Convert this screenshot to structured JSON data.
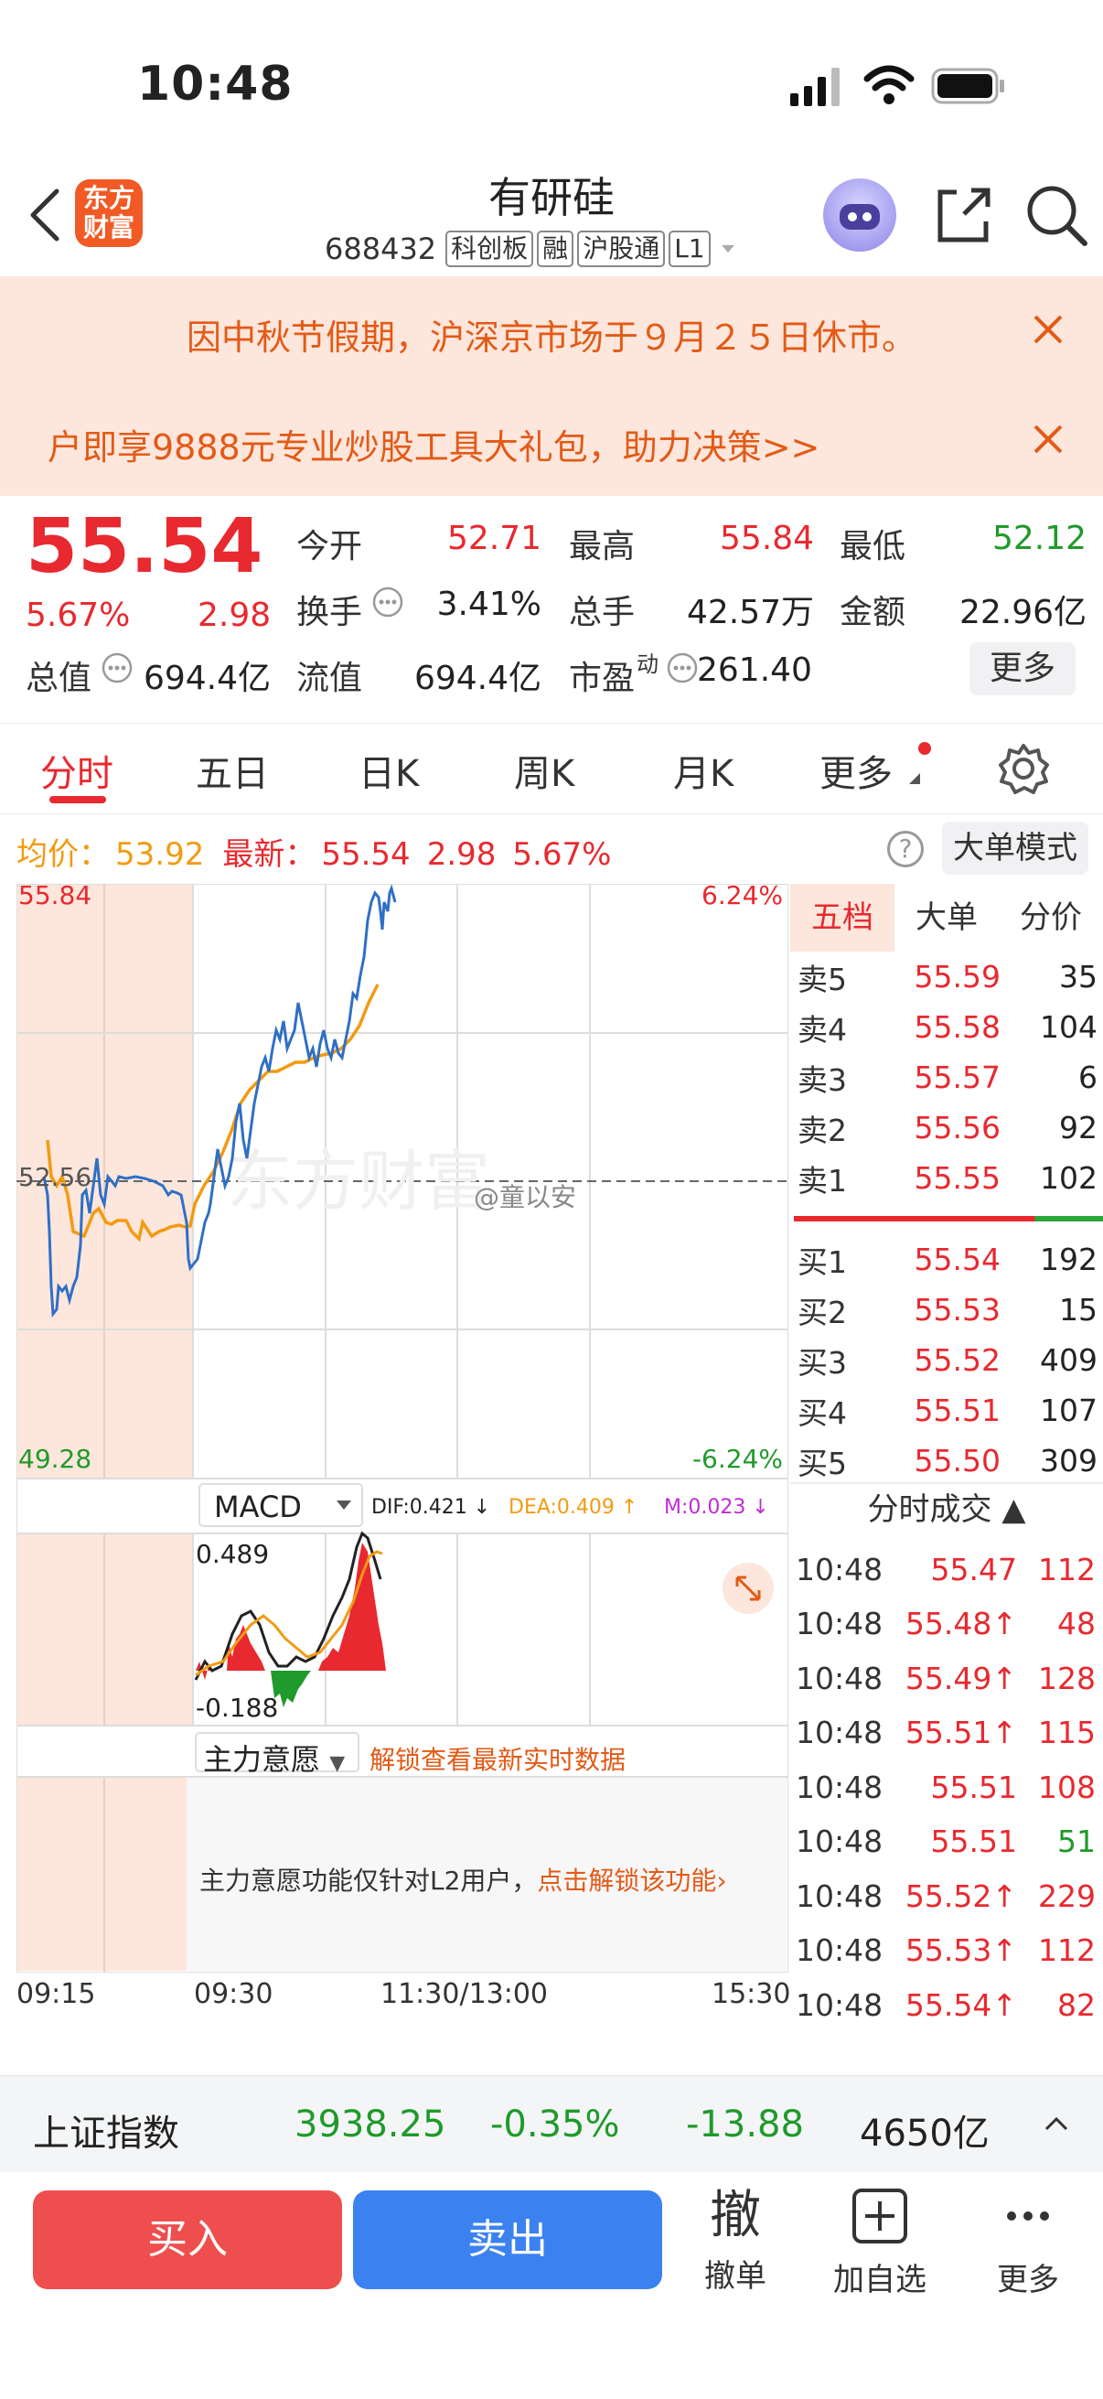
{
  "status": {
    "time": "10:48"
  },
  "header": {
    "logo_line1": "东方",
    "logo_line2": "财富",
    "name": "有研硅",
    "code": "688432",
    "tags": [
      "科创板",
      "融",
      "沪股通",
      "L1"
    ]
  },
  "banners": [
    "因中秋节假期，沪深京市场于９月２５日休市。",
    "户即享9888元专业炒股工具大礼包，助力决策>>"
  ],
  "quote": {
    "price": "55.54",
    "pct": "5.67%",
    "change": "2.98",
    "open_label": "今开",
    "open": "52.71",
    "high_label": "最高",
    "high": "55.84",
    "low_label": "最低",
    "low": "52.12",
    "turnover_label": "换手",
    "turnover": "3.41%",
    "volume_label": "总手",
    "volume": "42.57万",
    "amount_label": "金额",
    "amount": "22.96亿",
    "total_mv_label": "总值",
    "total_mv": "694.4亿",
    "float_mv_label": "流值",
    "float_mv": "694.4亿",
    "pe_label": "市盈",
    "pe_sup": "动",
    "pe": "261.40",
    "more": "更多"
  },
  "tabs": [
    "分时",
    "五日",
    "日K",
    "周K",
    "月K",
    "更多"
  ],
  "summary": {
    "avg_label": "均价：",
    "avg": "53.92",
    "latest_label": "最新：",
    "latest": "55.54",
    "latest_chg": "2.98",
    "latest_pct": "5.67%",
    "help": "?",
    "mode": "大单模式"
  },
  "chart": {
    "y_max": "55.84",
    "y_mid": "52.56",
    "y_min": "49.28",
    "pct_max": "6.24%",
    "pct_min": "-6.24%",
    "watermark": "东方财富",
    "weibo": "@童以安",
    "times": [
      "09:15",
      "09:30",
      "11:30/13:00",
      "15:30"
    ]
  },
  "macd": {
    "name": "MACD",
    "dif": "DIF:0.421 ↓",
    "dea": "DEA:0.409 ↑",
    "m": "M:0.023 ↓",
    "top": "0.489",
    "bottom": "-0.188"
  },
  "will": {
    "name": "主力意愿",
    "unlock": "解锁查看最新实时数据",
    "notice": "主力意愿功能仅针对L2用户，",
    "notice_link": "点击解锁该功能"
  },
  "orderbook": {
    "tabs": [
      "五档",
      "大单",
      "分价"
    ],
    "asks": [
      {
        "label": "卖5",
        "price": "55.59",
        "vol": "35"
      },
      {
        "label": "卖4",
        "price": "55.58",
        "vol": "104"
      },
      {
        "label": "卖3",
        "price": "55.57",
        "vol": "6"
      },
      {
        "label": "卖2",
        "price": "55.56",
        "vol": "92"
      },
      {
        "label": "卖1",
        "price": "55.55",
        "vol": "102"
      }
    ],
    "bids": [
      {
        "label": "买1",
        "price": "55.54",
        "vol": "192"
      },
      {
        "label": "买2",
        "price": "55.53",
        "vol": "15"
      },
      {
        "label": "买3",
        "price": "55.52",
        "vol": "409"
      },
      {
        "label": "买4",
        "price": "55.51",
        "vol": "107"
      },
      {
        "label": "买5",
        "price": "55.50",
        "vol": "309"
      }
    ]
  },
  "trades": {
    "title": "分时成交 ▲",
    "rows": [
      {
        "time": "10:48",
        "price": "55.47",
        "vol": "112",
        "pc": "#e8292f",
        "vc": "#e8292f"
      },
      {
        "time": "10:48",
        "price": "55.48↑",
        "vol": "48",
        "pc": "#e8292f",
        "vc": "#e8292f"
      },
      {
        "time": "10:48",
        "price": "55.49↑",
        "vol": "128",
        "pc": "#e8292f",
        "vc": "#e8292f"
      },
      {
        "time": "10:48",
        "price": "55.51↑",
        "vol": "115",
        "pc": "#e8292f",
        "vc": "#e8292f"
      },
      {
        "time": "10:48",
        "price": "55.51",
        "vol": "108",
        "pc": "#e8292f",
        "vc": "#e8292f"
      },
      {
        "time": "10:48",
        "price": "55.51",
        "vol": "51",
        "pc": "#e8292f",
        "vc": "#1f9a2b"
      },
      {
        "time": "10:48",
        "price": "55.52↑",
        "vol": "229",
        "pc": "#e8292f",
        "vc": "#e8292f"
      },
      {
        "time": "10:48",
        "price": "55.53↑",
        "vol": "112",
        "pc": "#e8292f",
        "vc": "#e8292f"
      },
      {
        "time": "10:48",
        "price": "55.54↑",
        "vol": "82",
        "pc": "#e8292f",
        "vc": "#e8292f"
      }
    ]
  },
  "index_bar": {
    "name": "上证指数",
    "value": "3938.25",
    "pct": "-0.35%",
    "chg": "-13.88",
    "amount": "4650亿"
  },
  "actions": {
    "buy": "买入",
    "sell": "卖出",
    "cancel_big": "撤",
    "cancel": "撤单",
    "add": "加自选",
    "more": "更多"
  },
  "colors": {
    "up": "#e8292f",
    "down": "#1f9a2b",
    "accent": "#e8292f",
    "price_line": "#2f6fc6",
    "avg_line": "#f29b11",
    "banner": "#fde6dc"
  }
}
